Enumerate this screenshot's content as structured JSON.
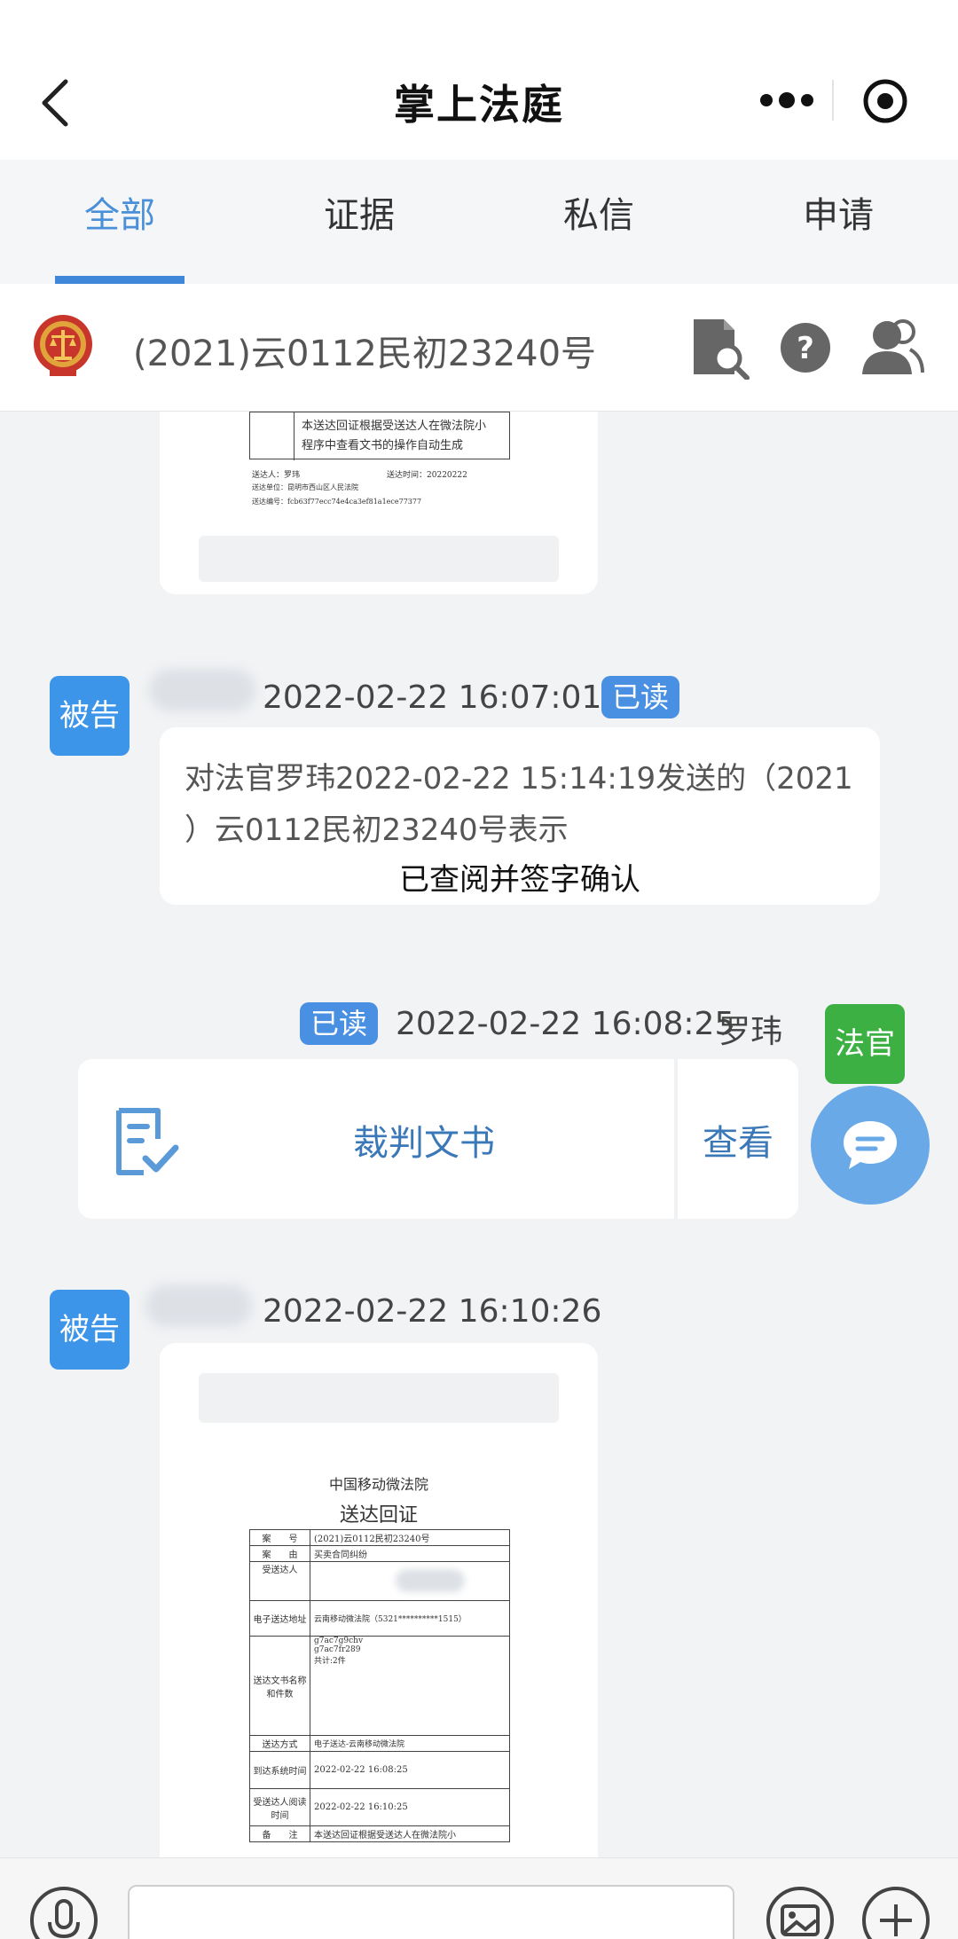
{
  "nav": {
    "title": "掌上法庭"
  },
  "tabs": [
    {
      "label": "全部",
      "active": true
    },
    {
      "label": "证据",
      "active": false
    },
    {
      "label": "私信",
      "active": false
    },
    {
      "label": "申请",
      "active": false
    }
  ],
  "case": {
    "number": "(2021)云0112民初23240号"
  },
  "doc_top": {
    "notes_fragment_1": "本送达回证根据受送达人在微法院小",
    "notes_fragment_2": "程序中查看文书的操作自动生成",
    "sender_label": "送达人：",
    "sender": "罗玮",
    "send_time_label": "送达时间：",
    "send_time": "20220222",
    "unit_label": "送达单位：",
    "unit": "昆明市西山区人民法院",
    "serial_label": "送达编号：",
    "serial": "fcb63f77ecc74e4ca3ef81a1ece77377"
  },
  "messages": [
    {
      "role": "被告",
      "timestamp": "2022-02-22 16:07:01",
      "status": "已读",
      "line1": "对法官罗玮2022-02-22 15:14:19发送的（2021",
      "line2": "）云0112民初23240号表示",
      "line3": "已查阅并签字确认"
    },
    {
      "role": "法官",
      "status": "已读",
      "timestamp": "2022-02-22 16:08:25",
      "sender": "罗玮",
      "card_title": "裁判文书",
      "card_action": "查看"
    },
    {
      "role": "被告",
      "timestamp": "2022-02-22 16:10:26"
    }
  ],
  "receipt": {
    "org": "中国移动微法院",
    "title": "送达回证",
    "rows": [
      {
        "label": "案　　号",
        "value": "(2021)云0112民初23240号"
      },
      {
        "label": "案　　由",
        "value": "买卖合同纠纷"
      },
      {
        "label": "受送达人",
        "value": ""
      },
      {
        "label": "电子送达地址",
        "value": "云南移动微法院（5321**********1515）"
      },
      {
        "label": "送达文书名称和件数",
        "value": "g7ac7g9chv\ng7ac7fr289\n共计:2件"
      },
      {
        "label": "送达方式",
        "value": "电子送达-云南移动微法院"
      },
      {
        "label": "到达系统时间",
        "value": "2022-02-22 16:08:25"
      },
      {
        "label": "受送达人阅读时间",
        "value": "2022-02-22 16:10:25"
      },
      {
        "label": "备　　注",
        "value": "本送达回证根据受送达人在微法院小"
      }
    ]
  },
  "colors": {
    "accent": "#3f87d8",
    "defendant_badge": "#3d95ea",
    "judge_badge": "#3cb043",
    "read_badge": "#4a90e2",
    "card_link": "#3b78b8"
  }
}
